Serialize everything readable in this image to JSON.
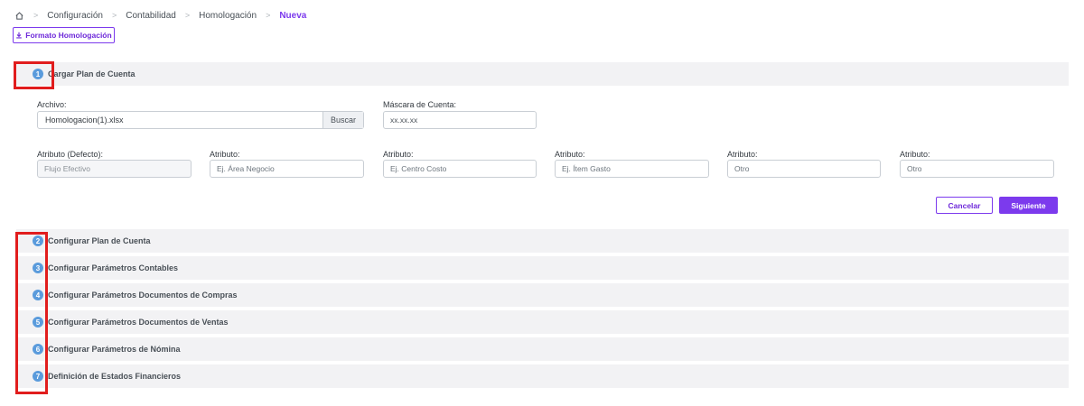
{
  "breadcrumb": {
    "items": [
      "Configuración",
      "Contabilidad",
      "Homologación"
    ],
    "active": "Nueva"
  },
  "actions": {
    "formato_label": "Formato Homologación"
  },
  "steps": [
    {
      "num": "1",
      "label": "Cargar Plan de Cuenta"
    },
    {
      "num": "2",
      "label": "Configurar Plan de Cuenta"
    },
    {
      "num": "3",
      "label": "Configurar Parámetros Contables"
    },
    {
      "num": "4",
      "label": "Configurar Parámetros Documentos de Compras"
    },
    {
      "num": "5",
      "label": "Configurar Parámetros Documentos de Ventas"
    },
    {
      "num": "6",
      "label": "Configurar Parámetros de Nómina"
    },
    {
      "num": "7",
      "label": "Definición de Estados Financieros"
    }
  ],
  "form": {
    "archivo_label": "Archivo:",
    "archivo_value": "Homologacion(1).xlsx",
    "buscar_label": "Buscar",
    "mascara_label": "Máscara de Cuenta:",
    "mascara_value": "xx.xx.xx",
    "attr_default_label": "Atributo (Defecto):",
    "attr_default_value": "Flujo Efectivo",
    "attr_label": "Atributo:",
    "attr_placeholders": [
      "Ej. Área Negocio",
      "Ej. Centro Costo",
      "Ej. Ítem Gasto",
      "Otro",
      "Otro"
    ]
  },
  "buttons": {
    "cancel": "Cancelar",
    "next": "Siguiente"
  },
  "colors": {
    "accent": "#7c3aed",
    "step_badge": "#5a9bdc",
    "highlight": "#e11d1d"
  }
}
